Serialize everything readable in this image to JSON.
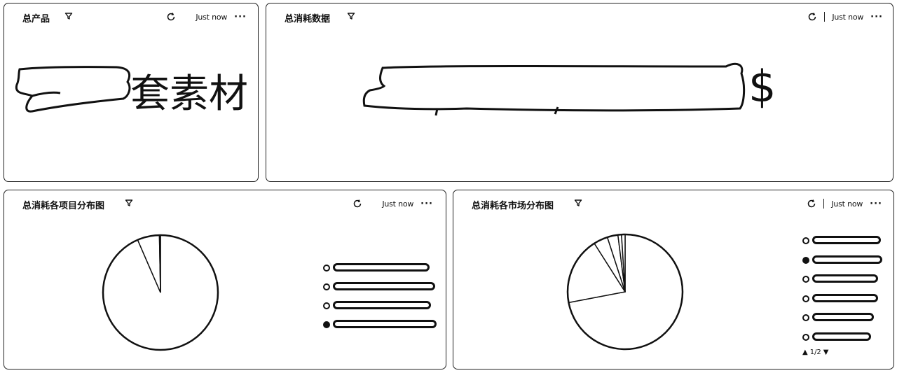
{
  "panels": {
    "total_products": {
      "title": "总产品",
      "timestamp": "Just now",
      "more": "···",
      "value_suffix": "套素材"
    },
    "total_spend": {
      "title": "总消耗数据",
      "timestamp": "Just now",
      "more": "···",
      "value_suffix": "$"
    },
    "spend_by_project": {
      "title": "总消耗各项目分布图",
      "timestamp": "Just now",
      "more": "···"
    },
    "spend_by_market": {
      "title": "总消耗各市场分布图",
      "timestamp": "Just now",
      "more": "···",
      "pager": "1/2"
    }
  },
  "icons": {
    "filter": "filter-icon",
    "refresh": "refresh-icon",
    "more": "more-icon"
  },
  "chart_data": [
    {
      "type": "pie",
      "title": "总消耗各项目分布图",
      "slices": [
        0.935,
        0.062,
        0.002,
        0.001
      ],
      "legend_count": 4
    },
    {
      "type": "pie",
      "title": "总消耗各市场分布图",
      "slices": [
        0.72,
        0.19,
        0.04,
        0.03,
        0.01,
        0.01
      ],
      "legend_count": 6
    }
  ]
}
